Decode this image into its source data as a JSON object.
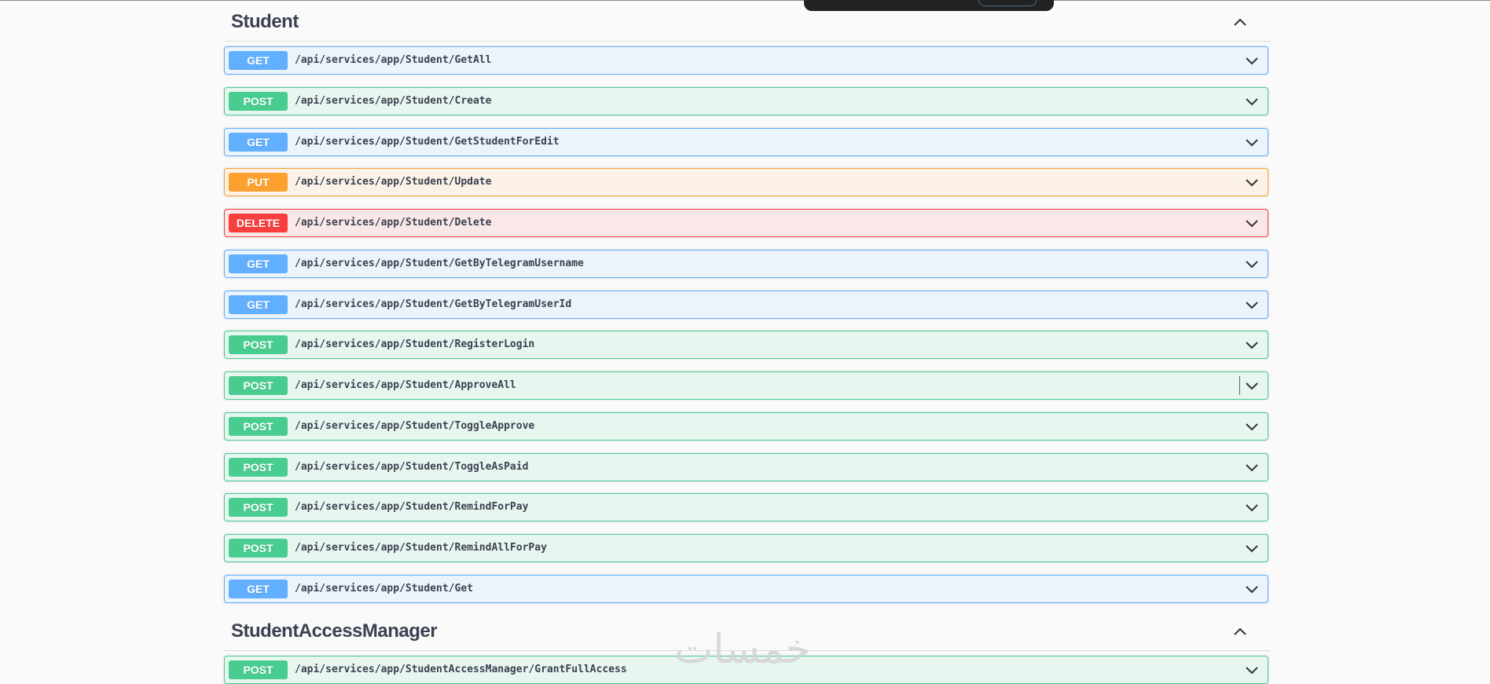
{
  "sections": [
    {
      "title": "Student",
      "operations": [
        {
          "method": "GET",
          "path": "/api/services/app/Student/GetAll"
        },
        {
          "method": "POST",
          "path": "/api/services/app/Student/Create"
        },
        {
          "method": "GET",
          "path": "/api/services/app/Student/GetStudentForEdit"
        },
        {
          "method": "PUT",
          "path": "/api/services/app/Student/Update"
        },
        {
          "method": "DELETE",
          "path": "/api/services/app/Student/Delete"
        },
        {
          "method": "GET",
          "path": "/api/services/app/Student/GetByTelegramUsername"
        },
        {
          "method": "GET",
          "path": "/api/services/app/Student/GetByTelegramUserId"
        },
        {
          "method": "POST",
          "path": "/api/services/app/Student/RegisterLogin"
        },
        {
          "method": "POST",
          "path": "/api/services/app/Student/ApproveAll"
        },
        {
          "method": "POST",
          "path": "/api/services/app/Student/ToggleApprove"
        },
        {
          "method": "POST",
          "path": "/api/services/app/Student/ToggleAsPaid"
        },
        {
          "method": "POST",
          "path": "/api/services/app/Student/RemindForPay"
        },
        {
          "method": "POST",
          "path": "/api/services/app/Student/RemindAllForPay"
        },
        {
          "method": "GET",
          "path": "/api/services/app/Student/Get"
        }
      ]
    },
    {
      "title": "StudentAccessManager",
      "operations": [
        {
          "method": "POST",
          "path": "/api/services/app/StudentAccessManager/GrantFullAccess"
        }
      ]
    }
  ],
  "icons": {
    "collapse": "chevron-up-icon",
    "expand": "chevron-down-icon"
  },
  "colors": {
    "get": "#61affe",
    "post": "#49cc90",
    "put": "#fca130",
    "delete": "#f93e3e"
  },
  "watermark": "خمسات"
}
